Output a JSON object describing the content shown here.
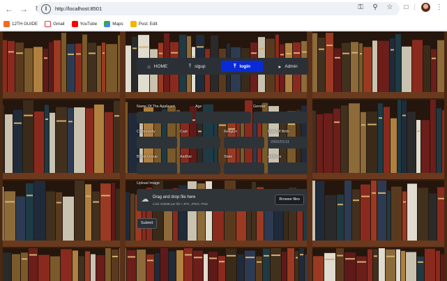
{
  "browser": {
    "url": "http://localhost:8501",
    "bookmarks": [
      "12TH GUIDE",
      "Gmail",
      "YouTube",
      "Maps",
      "Post: Edit"
    ]
  },
  "nav": {
    "items": [
      {
        "label": "HOME",
        "icon": "home-icon"
      },
      {
        "label": "sigup",
        "icon": "upload-icon"
      },
      {
        "label": "login",
        "icon": "upload-icon",
        "active": true
      },
      {
        "label": "Admin",
        "icon": "caret-right-icon"
      }
    ]
  },
  "form": {
    "row1": {
      "name_label": "Name Of The Applicant",
      "age_label": "Age",
      "gender_label": "Gender"
    },
    "row2": {
      "community_label": "Community",
      "cast_label": "Cast",
      "religion_label": "Religion",
      "dob_label": "Date Of Birth",
      "dob_value": "2000/01/11"
    },
    "row3": {
      "blood_label": "Blood Group",
      "aadhar_label": "Aadhar",
      "state_label": "State",
      "address_label": "Address"
    },
    "upload": {
      "label": "Upload Image",
      "title": "Drag and drop file here",
      "subtitle": "Limit 200MB per file • JPG, JPEG, PNG",
      "browse_label": "Browse files"
    },
    "submit_label": "Submit"
  },
  "colors": {
    "accent": "#0a2ad8",
    "field_bg": "#2e3338",
    "panel_bg": "#2b3036"
  }
}
